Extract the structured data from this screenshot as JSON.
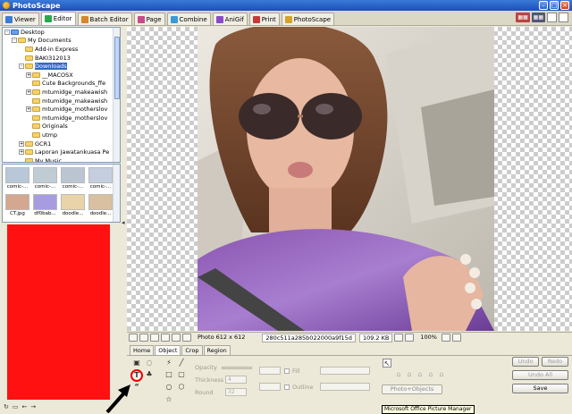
{
  "window": {
    "title": "PhotoScape"
  },
  "tabs": [
    {
      "label": "Viewer",
      "color": "#3b7bd6"
    },
    {
      "label": "Editor",
      "color": "#2aa84a",
      "active": true
    },
    {
      "label": "Batch Editor",
      "color": "#d6862a"
    },
    {
      "label": "Page",
      "color": "#c84a8a"
    },
    {
      "label": "Combine",
      "color": "#3a9ad6"
    },
    {
      "label": "AniGif",
      "color": "#8a4ac8"
    },
    {
      "label": "Print",
      "color": "#c83a3a"
    },
    {
      "label": "PhotoScape",
      "color": "#d6a32a"
    }
  ],
  "tree": {
    "items": [
      {
        "label": "Desktop",
        "depth": 0,
        "exp": "-"
      },
      {
        "label": "My Documents",
        "depth": 1,
        "exp": "-"
      },
      {
        "label": "Add-in Express",
        "depth": 2
      },
      {
        "label": "BAKI312013",
        "depth": 2
      },
      {
        "label": "Downloads",
        "depth": 2,
        "exp": "-",
        "selected": true
      },
      {
        "label": "__MACOSX",
        "depth": 3,
        "exp": "+"
      },
      {
        "label": "Cute Backgrounds_ffe",
        "depth": 3
      },
      {
        "label": "mtumidge_makeawish",
        "depth": 3,
        "exp": "+"
      },
      {
        "label": "mtumidge_makeawish",
        "depth": 3
      },
      {
        "label": "mtumidge_motherslov",
        "depth": 3,
        "exp": "+"
      },
      {
        "label": "mtumidge_motherslov",
        "depth": 3
      },
      {
        "label": "Originals",
        "depth": 3
      },
      {
        "label": "utmp",
        "depth": 3
      },
      {
        "label": "GCR1",
        "depth": 2,
        "exp": "+"
      },
      {
        "label": "Laporan Jawatankuasa Pe",
        "depth": 2,
        "exp": "+"
      },
      {
        "label": "My Music",
        "depth": 2
      }
    ]
  },
  "thumbnails": [
    {
      "label": "comic-...",
      "color": "#b8c8d8"
    },
    {
      "label": "comic-...",
      "color": "#c0ccd4"
    },
    {
      "label": "comic-...",
      "color": "#bcc6d2"
    },
    {
      "label": "comic-...",
      "color": "#c4cede"
    },
    {
      "label": "CT.jpg",
      "color": "#d4a890"
    },
    {
      "label": "df0bab...",
      "color": "#a89ce0"
    },
    {
      "label": "doodle...",
      "color": "#e8d4a8"
    },
    {
      "label": "doodle...",
      "color": "#d8c0a0"
    }
  ],
  "status": {
    "size": "Photo 612 x 612",
    "filename": "280c511a285b022000a9f15d",
    "filesize": "109.2 KB",
    "zoom": "100%"
  },
  "edit_tabs": [
    "Home",
    "Object",
    "Crop",
    "Region"
  ],
  "object_panel": {
    "opacity_label": "Opacity",
    "thickness_label": "Thickness",
    "thickness_value": "4",
    "round_label": "Round",
    "round_value": "32",
    "fill_label": "Fill",
    "outline_label": "Outline",
    "photo_objects": "Photo+Objects"
  },
  "buttons": {
    "undo": "Undo",
    "redo": "Redo",
    "undo_all": "Undo All",
    "save": "Save"
  },
  "tooltip": "Microsoft Office Picture Manager"
}
